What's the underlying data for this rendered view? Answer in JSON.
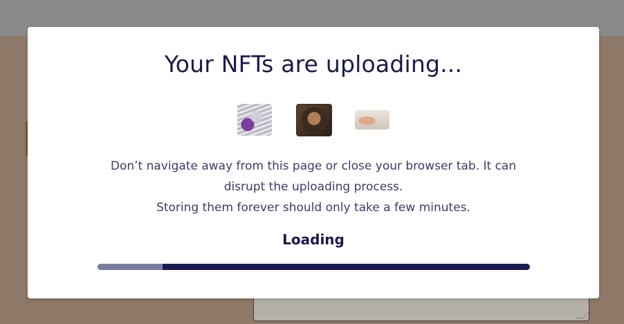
{
  "modal": {
    "title": "Your NFTs are uploading...",
    "message_lines": [
      "Don’t navigate away from this page or close your browser tab. It can",
      "disrupt the uploading process.",
      "Storing them forever should only take a few minutes."
    ],
    "loading_label": "Loading",
    "thumbnails": [
      {
        "name": "nft-thumbnail-1"
      },
      {
        "name": "nft-thumbnail-2"
      },
      {
        "name": "nft-thumbnail-3"
      }
    ]
  },
  "progress": {
    "fraction": 0.15
  },
  "colors": {
    "title": "#1a1a4e",
    "body_text": "#3b3b6b",
    "progress_track": "#1a1a52",
    "progress_fill": "#7b7ba1",
    "backdrop": "#8e7867"
  }
}
